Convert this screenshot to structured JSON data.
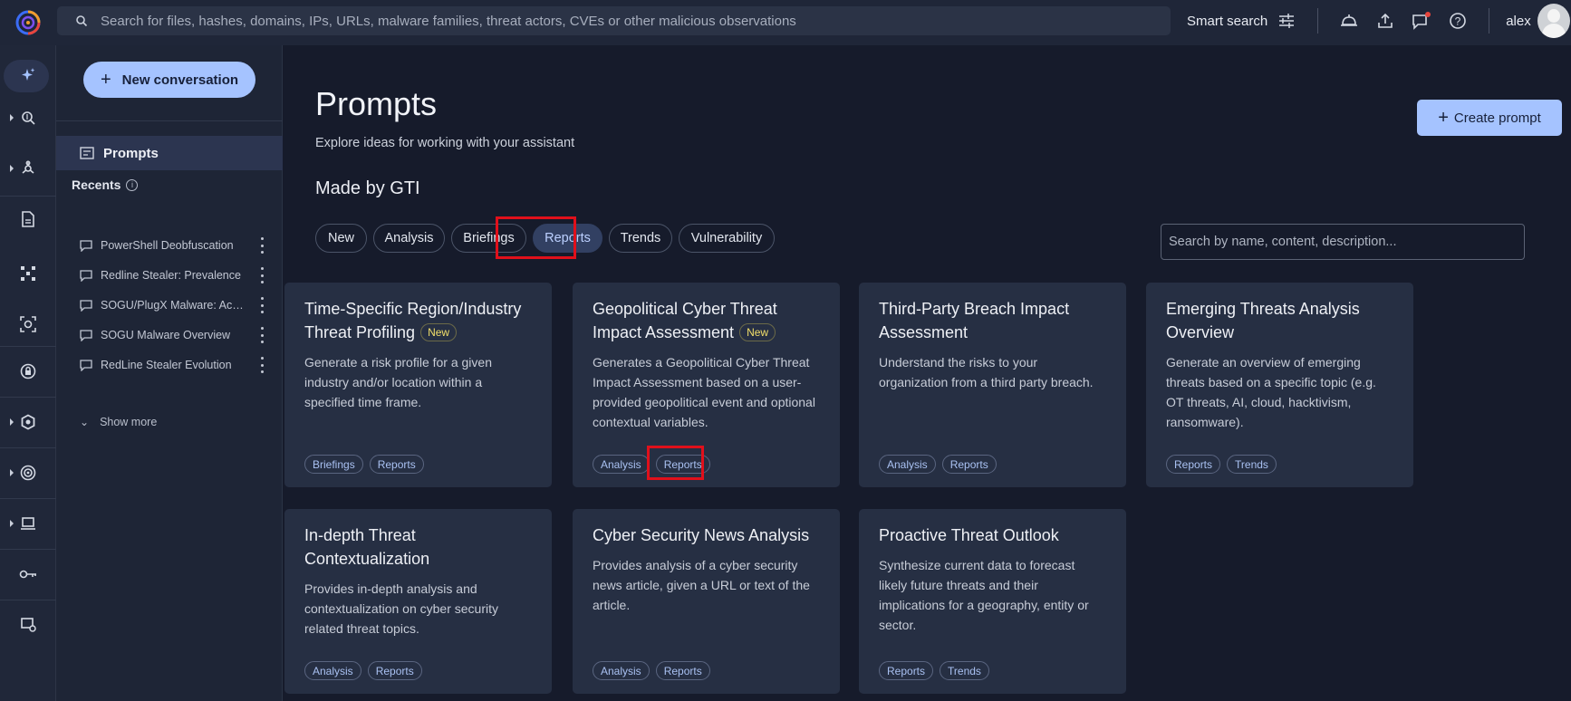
{
  "topbar": {
    "search_placeholder": "Search for files, hashes, domains, IPs, URLs, malware families, threat actors, CVEs or other malicious observations",
    "smart_search": "Smart search",
    "user": "alex"
  },
  "sidebar": {
    "new_conversation": "New conversation",
    "prompts": "Prompts",
    "recents_label": "Recents",
    "recents": [
      "PowerShell Deobfuscation",
      "Redline Stealer: Prevalence",
      "SOGU/PlugX Malware: Activity",
      "SOGU Malware Overview",
      "RedLine Stealer Evolution"
    ],
    "show_more": "Show more"
  },
  "main": {
    "title": "Prompts",
    "subtitle": "Explore ideas for working with your assistant",
    "create_prompt": "Create prompt",
    "section_title": "Made by GTI",
    "filters": [
      "New",
      "Analysis",
      "Briefings",
      "Reports",
      "Trends",
      "Vulnerability"
    ],
    "active_filter": "Reports",
    "filter_search_placeholder": "Search by name, content, description...",
    "new_badge": "New",
    "cards": [
      {
        "title": "Time-Specific Region/Industry Threat Profiling",
        "is_new": true,
        "description": "Generate a risk profile for a given industry and/or location within a specified time frame.",
        "tags": [
          "Briefings",
          "Reports"
        ]
      },
      {
        "title": "Geopolitical Cyber Threat Impact Assessment",
        "is_new": true,
        "description": "Generates a Geopolitical Cyber Threat Impact Assessment based on a user-provided geopolitical event and optional contextual variables.",
        "tags": [
          "Analysis",
          "Reports"
        ]
      },
      {
        "title": "Third-Party Breach Impact Assessment",
        "is_new": false,
        "description": "Understand the risks to your organization from a third party breach.",
        "tags": [
          "Analysis",
          "Reports"
        ]
      },
      {
        "title": "Emerging Threats Analysis Overview",
        "is_new": false,
        "description": "Generate an overview of emerging threats based on a specific topic (e.g. OT threats, AI, cloud, hacktivism, ransomware).",
        "tags": [
          "Reports",
          "Trends"
        ]
      },
      {
        "title": "In-depth Threat Contextualization",
        "is_new": false,
        "description": "Provides in-depth analysis and contextualization on cyber security related threat topics.",
        "tags": [
          "Analysis",
          "Reports"
        ]
      },
      {
        "title": "Cyber Security News Analysis",
        "is_new": false,
        "description": "Provides analysis of a cyber security news article, given a URL or text of the article.",
        "tags": [
          "Analysis",
          "Reports"
        ]
      },
      {
        "title": "Proactive Threat Outlook",
        "is_new": false,
        "description": "Synthesize current data to forecast likely future threats and their implications for a geography, entity or sector.",
        "tags": [
          "Reports",
          "Trends"
        ]
      }
    ]
  },
  "colors": {
    "accent": "#a5c3ff",
    "highlight": "#e0101b",
    "card_bg": "#262f43",
    "page_bg": "#161b2b"
  }
}
